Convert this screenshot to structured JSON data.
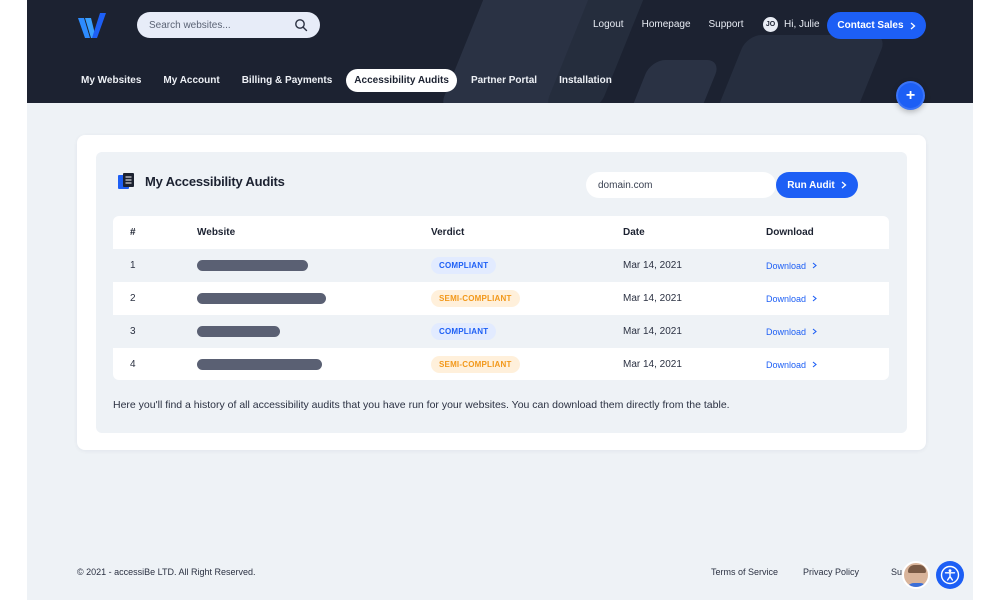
{
  "header": {
    "search": {
      "placeholder": "Search websites..."
    },
    "links": [
      "Logout",
      "Homepage",
      "Support"
    ],
    "user": {
      "initials": "JO",
      "greeting": "Hi, Julie"
    },
    "contact_label": "Contact Sales",
    "nav": [
      {
        "label": "My Websites",
        "active": false
      },
      {
        "label": "My Account",
        "active": false
      },
      {
        "label": "Billing & Payments",
        "active": false
      },
      {
        "label": "Accessibility Audits",
        "active": true
      },
      {
        "label": "Partner Portal",
        "active": false
      },
      {
        "label": "Installation",
        "active": false
      }
    ],
    "plus_label": "+"
  },
  "main": {
    "title": "My Accessibility Audits",
    "domain_value": "domain.com",
    "run_label": "Run Audit",
    "table": {
      "headers": [
        "#",
        "Website",
        "Verdict",
        "Date",
        "Download"
      ],
      "rows": [
        {
          "num": "1",
          "verdict": "COMPLIANT",
          "status": "ok",
          "date": "Mar 14, 2021",
          "download": "Download"
        },
        {
          "num": "2",
          "verdict": "SEMI-COMPLIANT",
          "status": "semi",
          "date": "Mar 14, 2021",
          "download": "Download"
        },
        {
          "num": "3",
          "verdict": "COMPLIANT",
          "status": "ok",
          "date": "Mar 14, 2021",
          "download": "Download"
        },
        {
          "num": "4",
          "verdict": "SEMI-COMPLIANT",
          "status": "semi",
          "date": "Mar 14, 2021",
          "download": "Download"
        }
      ]
    },
    "note": "Here you'll find a history of all accessibility audits that you have run for your websites. You can download them directly from the table."
  },
  "footer": {
    "copyright": "© 2021 - accessiBe LTD. All Right Reserved.",
    "links": [
      "Terms of Service",
      "Privacy Policy"
    ],
    "support_partial": "Su"
  },
  "colors": {
    "primary": "#1d5ff5",
    "header_bg": "#1c2231",
    "compliant": "#1d5ff5",
    "semi_compliant": "#f2981a"
  }
}
